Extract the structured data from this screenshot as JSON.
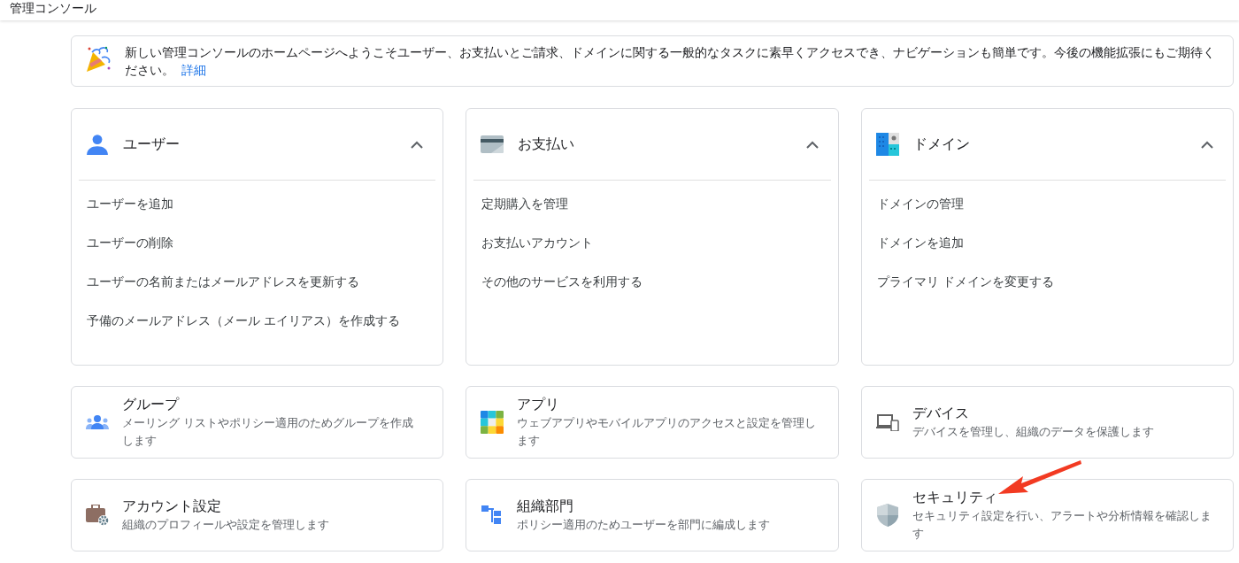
{
  "header": {
    "title": "管理コンソール"
  },
  "banner": {
    "text": "新しい管理コンソールのホームページへようこそユーザー、お支払いとご請求、ドメインに関する一般的なタスクに素早くアクセスでき、ナビゲーションも簡単です。今後の機能拡張にもご期待ください。",
    "link": "詳細"
  },
  "expanded_cards": [
    {
      "kind": "users",
      "title": "ユーザー",
      "expanded": true,
      "links": [
        "ユーザーを追加",
        "ユーザーの削除",
        "ユーザーの名前またはメールアドレスを更新する",
        "予備のメールアドレス（メール エイリアス）を作成する"
      ]
    },
    {
      "kind": "billing",
      "title": "お支払い",
      "expanded": true,
      "links": [
        "定期購入を管理",
        "お支払いアカウント",
        "その他のサービスを利用する"
      ]
    },
    {
      "kind": "domains",
      "title": "ドメイン",
      "expanded": true,
      "links": [
        "ドメインの管理",
        "ドメインを追加",
        "プライマリ ドメインを変更する"
      ]
    }
  ],
  "cards": [
    {
      "kind": "groups",
      "title": "グループ",
      "description": "メーリング リストやポリシー適用のためグループを作成します"
    },
    {
      "kind": "apps",
      "title": "アプリ",
      "description": "ウェブアプリやモバイルアプリのアクセスと設定を管理します"
    },
    {
      "kind": "devices",
      "title": "デバイス",
      "description": "デバイスを管理し、組織のデータを保護します"
    },
    {
      "kind": "account",
      "title": "アカウント設定",
      "description": "組織のプロフィールや設定を管理します"
    },
    {
      "kind": "org",
      "title": "組織部門",
      "description": "ポリシー適用のためユーザーを部門に編成します"
    },
    {
      "kind": "security",
      "title": "セキュリティ",
      "description": "セキュリティ設定を行い、アラートや分析情報を確認します"
    }
  ]
}
